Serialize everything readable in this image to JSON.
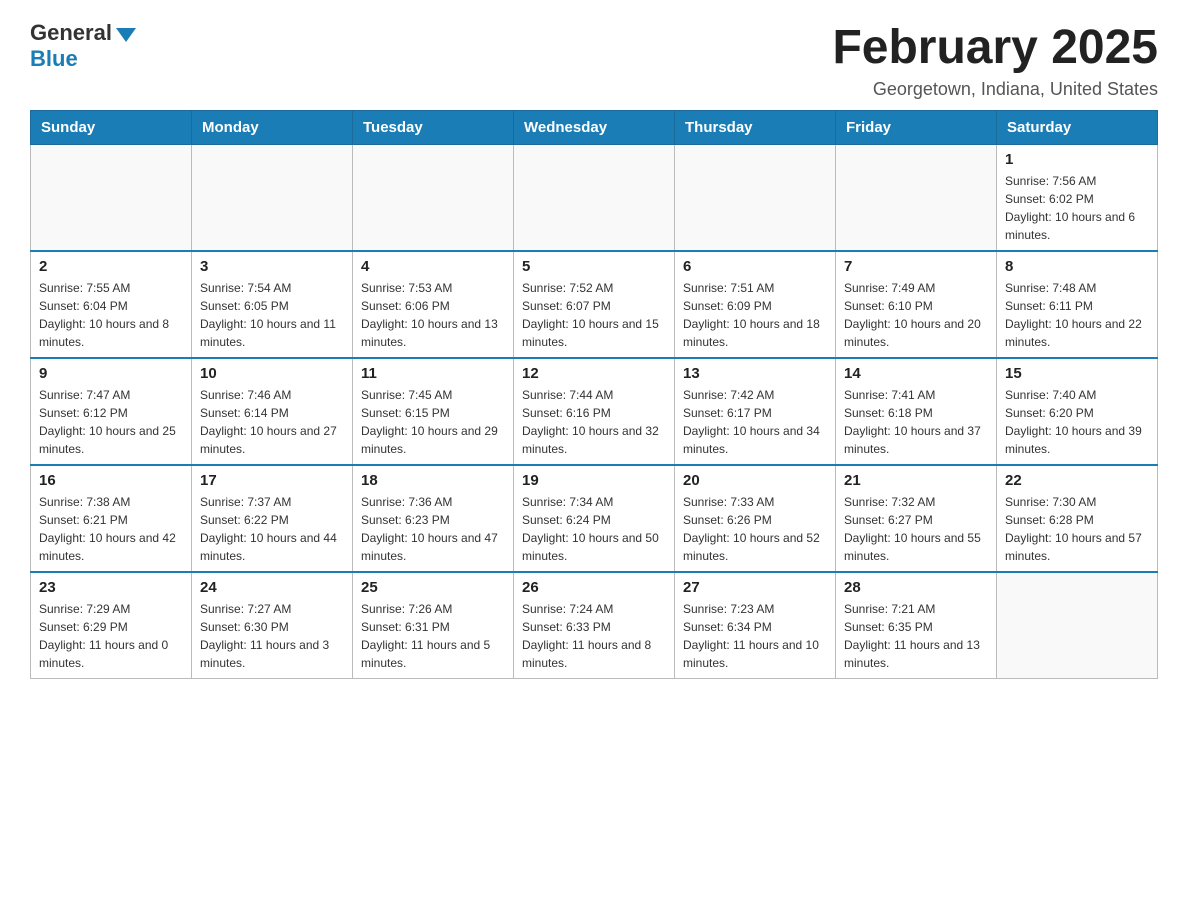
{
  "header": {
    "logo_general": "General",
    "logo_blue": "Blue",
    "month_title": "February 2025",
    "location": "Georgetown, Indiana, United States"
  },
  "days_of_week": [
    "Sunday",
    "Monday",
    "Tuesday",
    "Wednesday",
    "Thursday",
    "Friday",
    "Saturday"
  ],
  "weeks": [
    [
      {
        "day": "",
        "info": ""
      },
      {
        "day": "",
        "info": ""
      },
      {
        "day": "",
        "info": ""
      },
      {
        "day": "",
        "info": ""
      },
      {
        "day": "",
        "info": ""
      },
      {
        "day": "",
        "info": ""
      },
      {
        "day": "1",
        "info": "Sunrise: 7:56 AM\nSunset: 6:02 PM\nDaylight: 10 hours and 6 minutes."
      }
    ],
    [
      {
        "day": "2",
        "info": "Sunrise: 7:55 AM\nSunset: 6:04 PM\nDaylight: 10 hours and 8 minutes."
      },
      {
        "day": "3",
        "info": "Sunrise: 7:54 AM\nSunset: 6:05 PM\nDaylight: 10 hours and 11 minutes."
      },
      {
        "day": "4",
        "info": "Sunrise: 7:53 AM\nSunset: 6:06 PM\nDaylight: 10 hours and 13 minutes."
      },
      {
        "day": "5",
        "info": "Sunrise: 7:52 AM\nSunset: 6:07 PM\nDaylight: 10 hours and 15 minutes."
      },
      {
        "day": "6",
        "info": "Sunrise: 7:51 AM\nSunset: 6:09 PM\nDaylight: 10 hours and 18 minutes."
      },
      {
        "day": "7",
        "info": "Sunrise: 7:49 AM\nSunset: 6:10 PM\nDaylight: 10 hours and 20 minutes."
      },
      {
        "day": "8",
        "info": "Sunrise: 7:48 AM\nSunset: 6:11 PM\nDaylight: 10 hours and 22 minutes."
      }
    ],
    [
      {
        "day": "9",
        "info": "Sunrise: 7:47 AM\nSunset: 6:12 PM\nDaylight: 10 hours and 25 minutes."
      },
      {
        "day": "10",
        "info": "Sunrise: 7:46 AM\nSunset: 6:14 PM\nDaylight: 10 hours and 27 minutes."
      },
      {
        "day": "11",
        "info": "Sunrise: 7:45 AM\nSunset: 6:15 PM\nDaylight: 10 hours and 29 minutes."
      },
      {
        "day": "12",
        "info": "Sunrise: 7:44 AM\nSunset: 6:16 PM\nDaylight: 10 hours and 32 minutes."
      },
      {
        "day": "13",
        "info": "Sunrise: 7:42 AM\nSunset: 6:17 PM\nDaylight: 10 hours and 34 minutes."
      },
      {
        "day": "14",
        "info": "Sunrise: 7:41 AM\nSunset: 6:18 PM\nDaylight: 10 hours and 37 minutes."
      },
      {
        "day": "15",
        "info": "Sunrise: 7:40 AM\nSunset: 6:20 PM\nDaylight: 10 hours and 39 minutes."
      }
    ],
    [
      {
        "day": "16",
        "info": "Sunrise: 7:38 AM\nSunset: 6:21 PM\nDaylight: 10 hours and 42 minutes."
      },
      {
        "day": "17",
        "info": "Sunrise: 7:37 AM\nSunset: 6:22 PM\nDaylight: 10 hours and 44 minutes."
      },
      {
        "day": "18",
        "info": "Sunrise: 7:36 AM\nSunset: 6:23 PM\nDaylight: 10 hours and 47 minutes."
      },
      {
        "day": "19",
        "info": "Sunrise: 7:34 AM\nSunset: 6:24 PM\nDaylight: 10 hours and 50 minutes."
      },
      {
        "day": "20",
        "info": "Sunrise: 7:33 AM\nSunset: 6:26 PM\nDaylight: 10 hours and 52 minutes."
      },
      {
        "day": "21",
        "info": "Sunrise: 7:32 AM\nSunset: 6:27 PM\nDaylight: 10 hours and 55 minutes."
      },
      {
        "day": "22",
        "info": "Sunrise: 7:30 AM\nSunset: 6:28 PM\nDaylight: 10 hours and 57 minutes."
      }
    ],
    [
      {
        "day": "23",
        "info": "Sunrise: 7:29 AM\nSunset: 6:29 PM\nDaylight: 11 hours and 0 minutes."
      },
      {
        "day": "24",
        "info": "Sunrise: 7:27 AM\nSunset: 6:30 PM\nDaylight: 11 hours and 3 minutes."
      },
      {
        "day": "25",
        "info": "Sunrise: 7:26 AM\nSunset: 6:31 PM\nDaylight: 11 hours and 5 minutes."
      },
      {
        "day": "26",
        "info": "Sunrise: 7:24 AM\nSunset: 6:33 PM\nDaylight: 11 hours and 8 minutes."
      },
      {
        "day": "27",
        "info": "Sunrise: 7:23 AM\nSunset: 6:34 PM\nDaylight: 11 hours and 10 minutes."
      },
      {
        "day": "28",
        "info": "Sunrise: 7:21 AM\nSunset: 6:35 PM\nDaylight: 11 hours and 13 minutes."
      },
      {
        "day": "",
        "info": ""
      }
    ]
  ]
}
